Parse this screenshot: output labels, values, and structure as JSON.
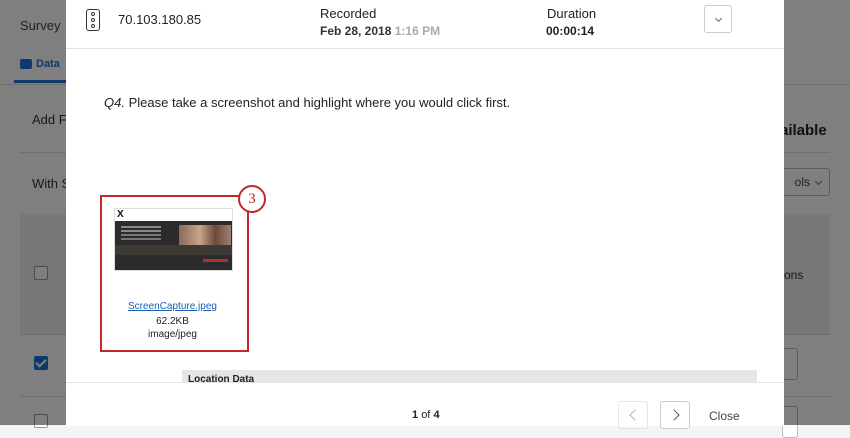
{
  "background": {
    "survey_label": "Survey",
    "data_tab_label": "Data",
    "add_filter_label": "Add Fi",
    "with_selected_label": "With S",
    "available_label": "ailable",
    "tools_label": "ols",
    "column_label": "ons"
  },
  "modal": {
    "ip_address": "70.103.180.85",
    "recorded_label": "Recorded",
    "recorded_date": "Feb 28, 2018",
    "recorded_time": "1:16 PM",
    "duration_label": "Duration",
    "duration_value": "00:00:14",
    "question_number": "Q4.",
    "question_text": "Please take a screenshot and highlight where you would click first.",
    "badge_number": "3",
    "attachment": {
      "file_name": "ScreenCapture.jpeg",
      "file_size": "62.2KB",
      "file_type": "image/jpeg",
      "thumb_logo": "X"
    },
    "location_label": "Location Data",
    "pager_current": "1",
    "pager_of": "of",
    "pager_total": "4",
    "close_label": "Close"
  },
  "colors": {
    "highlight": "#c0282c",
    "link": "#1a5fb4",
    "accent": "#1a73d9"
  }
}
